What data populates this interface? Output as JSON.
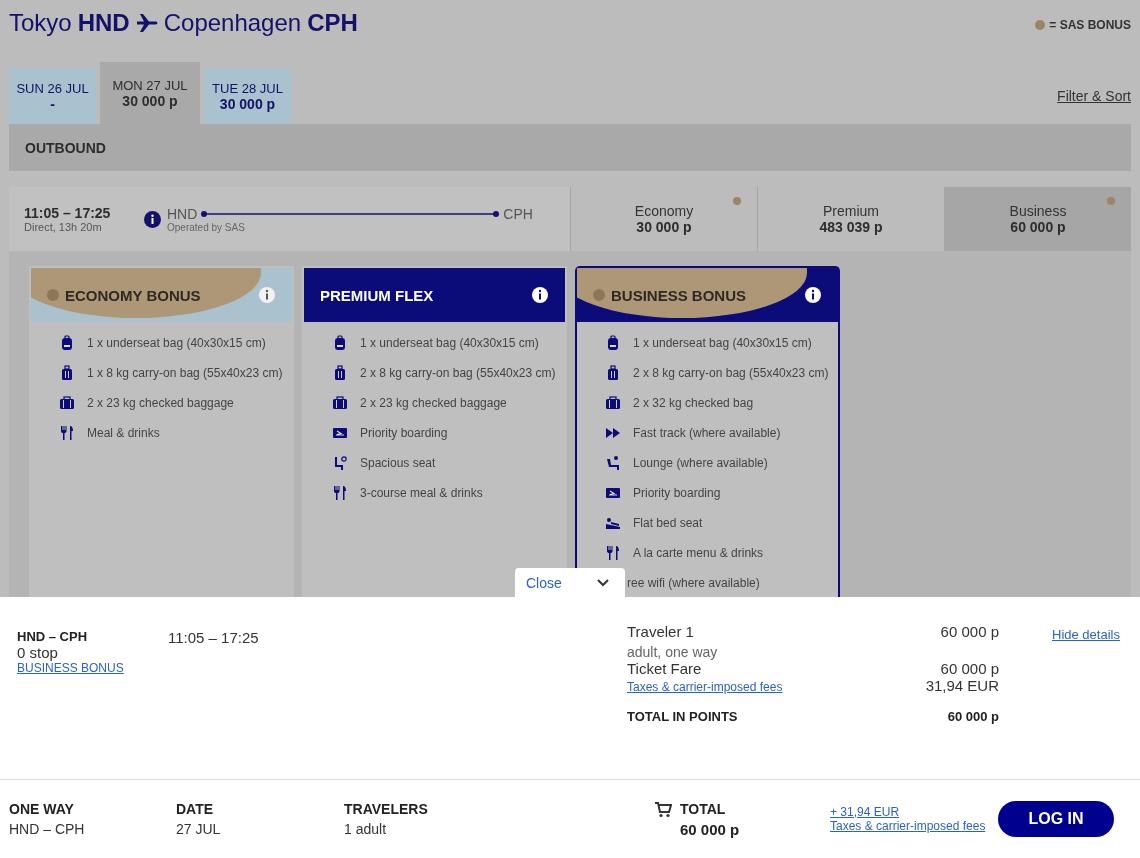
{
  "header": {
    "origin_city": "Tokyo",
    "origin_code": "HND",
    "destination_city": "Copenhagen",
    "destination_code": "CPH",
    "legend": "= SAS BONUS"
  },
  "date_tabs": [
    {
      "day": "SUN 26 JUL",
      "price": "-",
      "selected": false
    },
    {
      "day": "MON 27 JUL",
      "price": "30 000 p",
      "selected": true
    },
    {
      "day": "TUE 28 JUL",
      "price": "30 000 p",
      "selected": false
    }
  ],
  "filter_link": "Filter & Sort",
  "section_title": "OUTBOUND",
  "flight": {
    "times": "11:05 – 17:25",
    "duration": "Direct, 13h 20m",
    "from": "HND",
    "to": "CPH",
    "operator": "Operated by SAS",
    "fares": [
      {
        "cabin": "Economy",
        "price": "30 000 p",
        "bonus": true,
        "selected": false
      },
      {
        "cabin": "Premium",
        "price": "483 039 p",
        "bonus": false,
        "selected": false
      },
      {
        "cabin": "Business",
        "price": "60 000 p",
        "bonus": true,
        "selected": true
      }
    ]
  },
  "fare_cards": [
    {
      "title": "ECONOMY BONUS",
      "kind": "economy",
      "selected": false,
      "amenities": [
        {
          "kind": "backpack",
          "text": "1 x underseat bag (40x30x15 cm)"
        },
        {
          "kind": "trolley",
          "text": "1 x 8 kg carry-on bag (55x40x23 cm)"
        },
        {
          "kind": "suitcase",
          "text": "2 x 23 kg checked baggage"
        },
        {
          "kind": "meal",
          "text": "Meal & drinks"
        }
      ]
    },
    {
      "title": "PREMIUM FLEX",
      "kind": "flex",
      "selected": false,
      "amenities": [
        {
          "kind": "backpack",
          "text": "1 x underseat bag (40x30x15 cm)"
        },
        {
          "kind": "trolley",
          "text": "2 x 8 kg carry-on bag (55x40x23 cm)"
        },
        {
          "kind": "suitcase",
          "text": "2 x 23 kg checked baggage"
        },
        {
          "kind": "boarding",
          "text": "Priority boarding"
        },
        {
          "kind": "seat",
          "text": "Spacious seat"
        },
        {
          "kind": "meal",
          "text": "3-course meal & drinks"
        }
      ]
    },
    {
      "title": "BUSINESS BONUS",
      "kind": "business",
      "selected": true,
      "amenities": [
        {
          "kind": "backpack",
          "text": "1 x underseat bag (40x30x15 cm)"
        },
        {
          "kind": "trolley",
          "text": "2 x 8 kg carry-on bag (55x40x23 cm)"
        },
        {
          "kind": "suitcase",
          "text": "2 x 32 kg checked bag"
        },
        {
          "kind": "fasttrack",
          "text": "Fast track (where available)"
        },
        {
          "kind": "lounge",
          "text": "Lounge (where available)"
        },
        {
          "kind": "boarding",
          "text": "Priority boarding"
        },
        {
          "kind": "bed",
          "text": "Flat bed seat"
        },
        {
          "kind": "meal",
          "text": "A la carte menu & drinks"
        },
        {
          "kind": "covered",
          "text": "ree wifi (where available)"
        }
      ]
    }
  ],
  "close_tab": {
    "label": "Close"
  },
  "details": {
    "route": "HND – CPH",
    "stops": "0 stop",
    "fare_link": "BUSINESS BONUS",
    "times": "11:05 – 17:25",
    "traveler": "Traveler 1",
    "traveler_price": "60 000 p",
    "hide_link": "Hide details",
    "traveler_type": "adult, one way",
    "ticket_label": "Ticket Fare",
    "ticket_price": "60 000 p",
    "taxes_link": "Taxes & carrier-imposed fees",
    "taxes_amount": "31,94 EUR",
    "total_label": "TOTAL IN POINTS",
    "total_value": "60 000 p"
  },
  "footer": {
    "trip_label": "ONE WAY",
    "trip_value": "HND – CPH",
    "date_label": "DATE",
    "date_value": "27 JUL",
    "travelers_label": "TRAVELERS",
    "travelers_value": "1 adult",
    "total_label": "TOTAL",
    "total_value": "60 000 p",
    "fees_amount_link": "+ 31,94 EUR",
    "fees_link": "Taxes & carrier-imposed fees",
    "login_button": "LOG IN"
  }
}
